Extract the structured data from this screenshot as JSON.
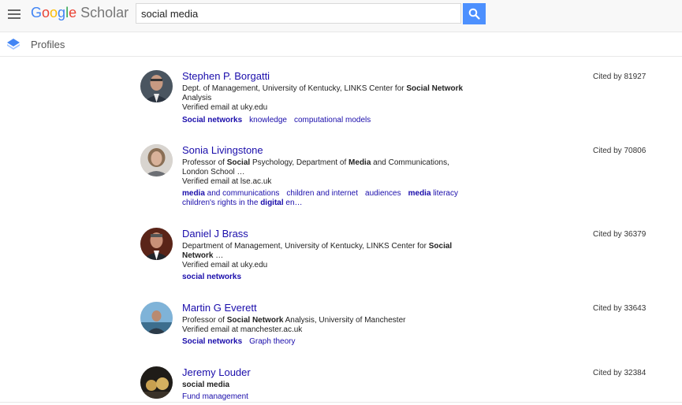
{
  "header": {
    "logo_google": "Google",
    "logo_scholar": "Scholar",
    "search_value": "social media"
  },
  "profiles_bar": {
    "label": "Profiles"
  },
  "results": [
    {
      "name": "Stephen P. Borgatti",
      "affil_pre": "Dept. of Management, University of Kentucky, LINKS Center for ",
      "affil_bold": "Social Network",
      "affil_post": " Analysis",
      "email": "Verified email at uky.edu",
      "tags": [
        "Social networks",
        "knowledge",
        "computational models"
      ],
      "cited": "Cited by 81927"
    },
    {
      "name": "Sonia Livingstone",
      "affil_1": "Professor of ",
      "affil_2": "Social",
      "affil_3": " Psychology, Department of ",
      "affil_4": "Media",
      "affil_5": " and Communications, London School …",
      "email": "Verified email at lse.ac.uk",
      "tag1_bold": "media",
      "tag1_rest": " and communications",
      "tag2": "children and internet",
      "tag3": "audiences",
      "tag4_bold": "media",
      "tag4_rest": " literacy",
      "tag5_pre": "children's rights in the ",
      "tag5_bold": "digital",
      "tag5_post": " en…",
      "cited": "Cited by 70806"
    },
    {
      "name": "Daniel J Brass",
      "affil_pre": "Department of Management, University of Kentucky, LINKS Center for ",
      "affil_bold": "Social Network",
      "affil_post": " …",
      "email": "Verified email at uky.edu",
      "tag1": "social networks",
      "cited": "Cited by 36379"
    },
    {
      "name": "Martin G Everett",
      "affil_pre": "Professor of ",
      "affil_bold": "Social Network",
      "affil_post": " Analysis, University of Manchester",
      "email": "Verified email at manchester.ac.uk",
      "tags": [
        "Social networks",
        "Graph theory"
      ],
      "cited": "Cited by 33643"
    },
    {
      "name": "Jeremy Louder",
      "affil_bold": "social media",
      "tag1": "Fund management",
      "cited": "Cited by 32384"
    }
  ]
}
